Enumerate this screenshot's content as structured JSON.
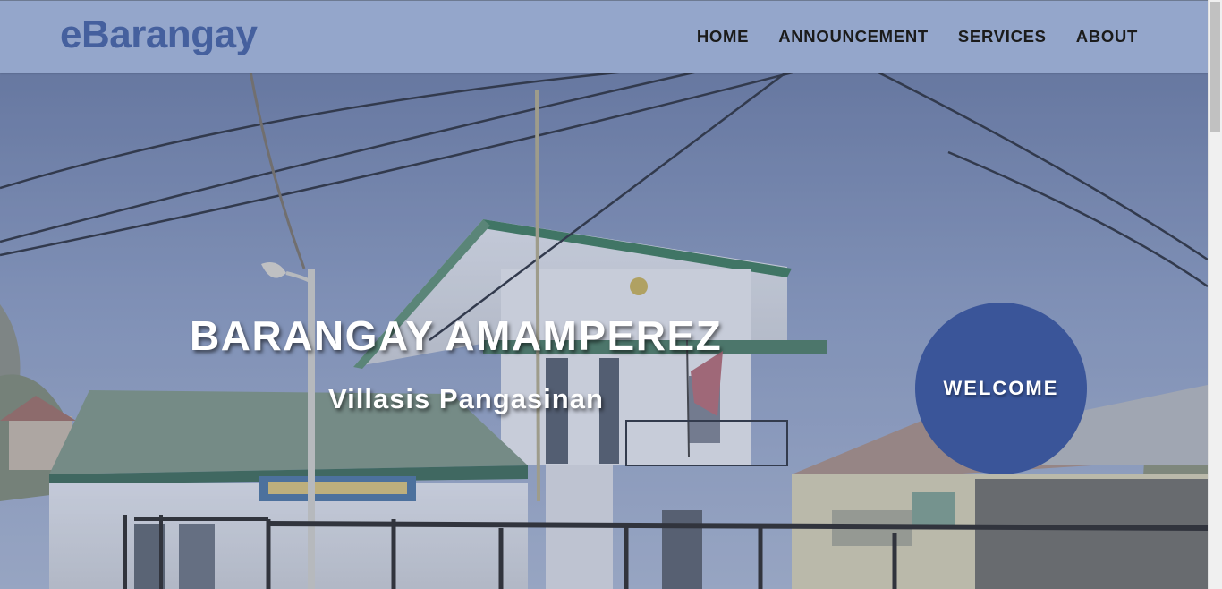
{
  "header": {
    "brand": "eBarangay",
    "nav": [
      {
        "label": "HOME"
      },
      {
        "label": "ANNOUNCEMENT"
      },
      {
        "label": "SERVICES"
      },
      {
        "label": "ABOUT"
      }
    ]
  },
  "hero": {
    "title": "BARANGAY AMAMPEREZ",
    "subtitle": "Villasis Pangasinan",
    "welcome_label": "WELCOME"
  },
  "colors": {
    "header_bg": "#94a6cb",
    "brand": "#45609e",
    "welcome_circle": "#3a5599"
  },
  "icons": {
    "hero_image": "barangay-hall-photo"
  }
}
